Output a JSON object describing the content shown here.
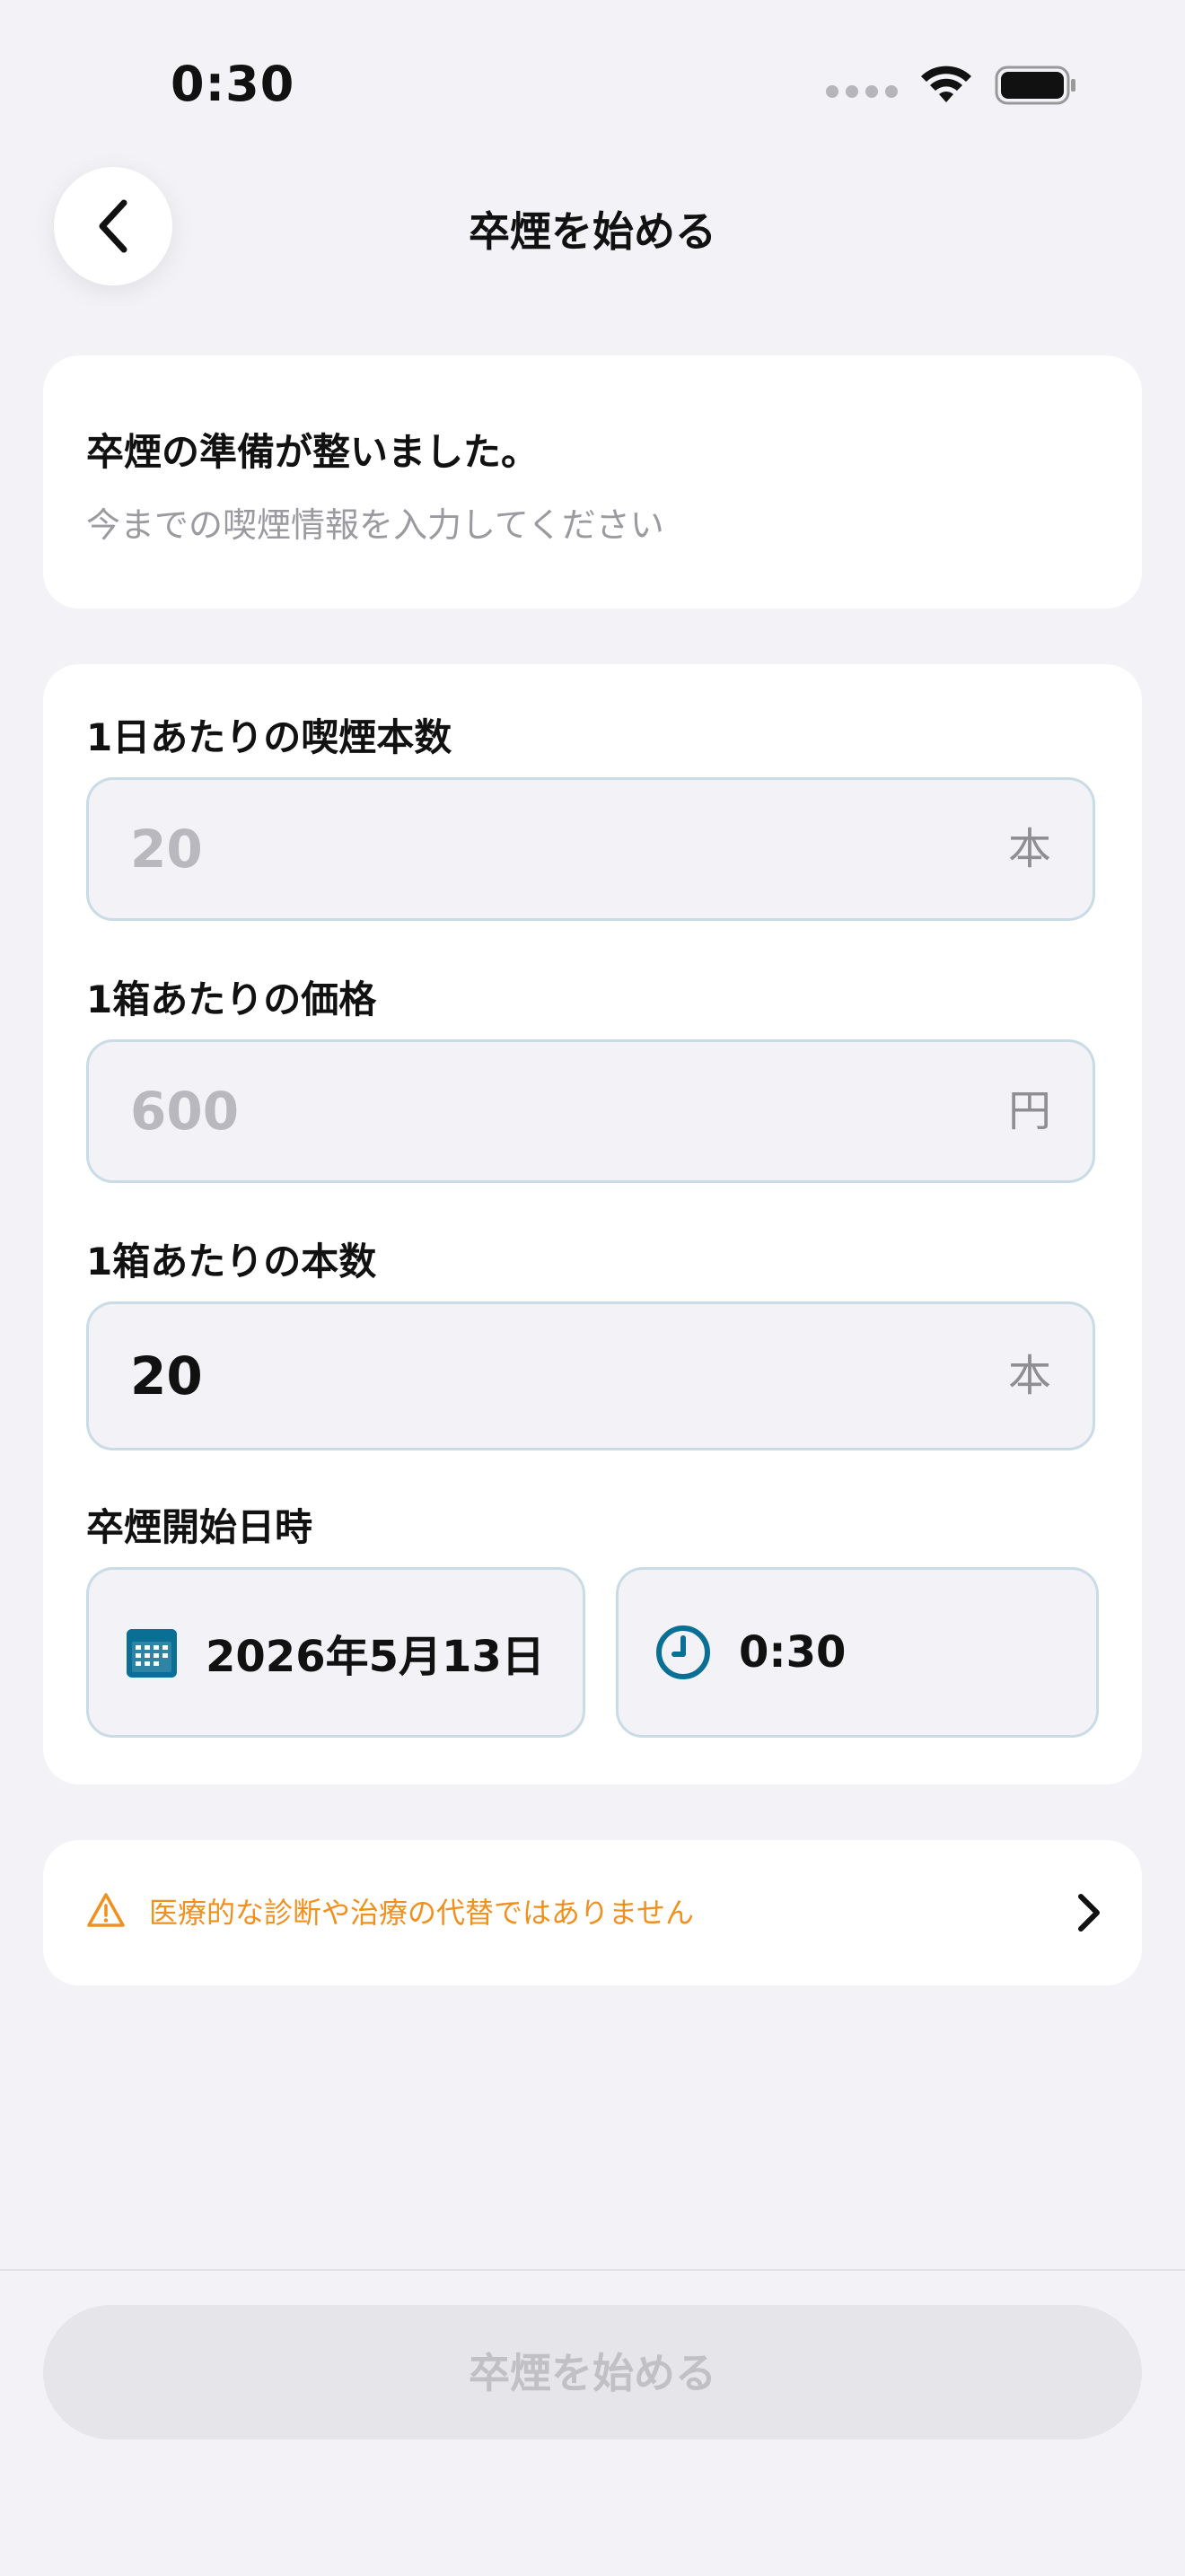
{
  "status_bar": {
    "time": "0:30"
  },
  "nav": {
    "title": "卒煙を始める"
  },
  "intro": {
    "title": "卒煙の準備が整いました。",
    "subtitle": "今までの喫煙情報を入力してください"
  },
  "form": {
    "daily_count": {
      "label": "1日あたりの喫煙本数",
      "placeholder": "20",
      "unit": "本"
    },
    "pack_price": {
      "label": "1箱あたりの価格",
      "placeholder": "600",
      "unit": "円"
    },
    "pack_count": {
      "label": "1箱あたりの本数",
      "value": "20",
      "unit": "本"
    },
    "start": {
      "label": "卒煙開始日時",
      "date": "2026年5月13日",
      "time": "0:30"
    }
  },
  "notice": {
    "text": "医療的な診断や治療の代替ではありません"
  },
  "footer": {
    "start_button": "卒煙を始める"
  },
  "colors": {
    "accent": "#0a6f94",
    "warning": "#f0901e",
    "background": "#f2f2f7",
    "field_border": "#c9dce6"
  }
}
